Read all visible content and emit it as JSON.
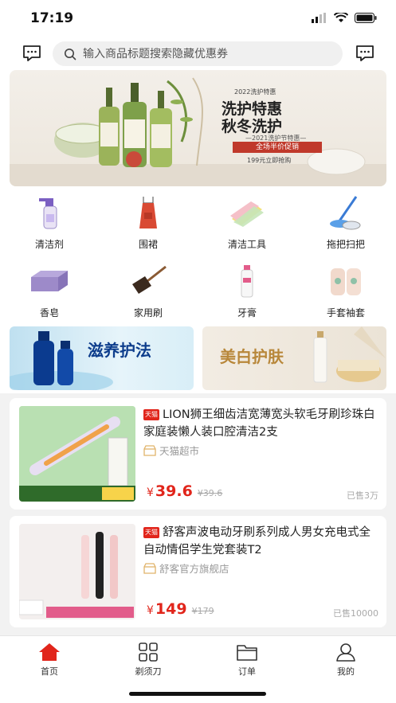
{
  "status": {
    "time": "17:19"
  },
  "search": {
    "placeholder": "输入商品标题搜索隐藏优惠券"
  },
  "banner": {
    "year": "2022洗护特惠",
    "title1": "洗护特惠",
    "title2": "秋冬洗护",
    "festival": "—2021洗护节特惠—",
    "promo": "全场半价促销",
    "sub": "199元立即抢购"
  },
  "categories": [
    {
      "label": "清洁剂",
      "icon": "spray-bottle-icon"
    },
    {
      "label": "围裙",
      "icon": "apron-icon"
    },
    {
      "label": "清洁工具",
      "icon": "cloths-icon"
    },
    {
      "label": "拖把扫把",
      "icon": "mop-icon"
    },
    {
      "label": "香皂",
      "icon": "soap-icon"
    },
    {
      "label": "家用刷",
      "icon": "brush-icon"
    },
    {
      "label": "牙膏",
      "icon": "toothpaste-icon"
    },
    {
      "label": "手套袖套",
      "icon": "sleeves-icon"
    }
  ],
  "promos": {
    "left": {
      "title": "滋养护法"
    },
    "right": {
      "title": "美白护肤"
    }
  },
  "products": [
    {
      "badge": "天猫",
      "title": "LION狮王细齿洁宽薄宽头软毛牙刷珍珠白家庭装懒人装口腔清洁2支",
      "shop": "天猫超市",
      "price": "39.6",
      "old_price": "¥39.6",
      "sold": "已售3万"
    },
    {
      "badge": "天猫",
      "title": "舒客声波电动牙刷系列成人男女充电式全自动情侣学生党套装T2",
      "shop": "舒客官方旗舰店",
      "price": "149",
      "old_price": "¥179",
      "sold": "已售10000"
    }
  ],
  "nav": [
    {
      "label": "首页",
      "icon": "home-icon",
      "active": true
    },
    {
      "label": "剃须刀",
      "icon": "grid-icon",
      "active": false
    },
    {
      "label": "订单",
      "icon": "folder-icon",
      "active": false
    },
    {
      "label": "我的",
      "icon": "user-icon",
      "active": false
    }
  ],
  "colors": {
    "accent": "#e1251b",
    "tmall": "#e1251b"
  }
}
